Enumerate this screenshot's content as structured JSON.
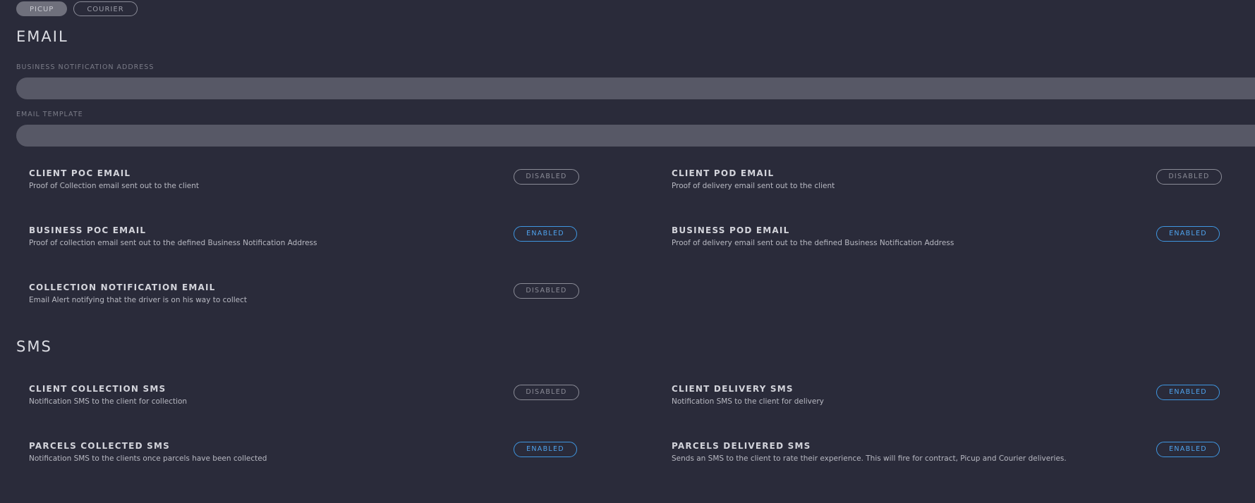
{
  "tabs": [
    {
      "label": "PICUP",
      "active": true
    },
    {
      "label": "COURIER",
      "active": false
    }
  ],
  "email": {
    "title": "EMAIL",
    "business_address_label": "BUSINESS NOTIFICATION ADDRESS",
    "business_address_value": "",
    "template_label": "EMAIL TEMPLATE",
    "template_value": "",
    "settings": [
      {
        "name": "CLIENT POC EMAIL",
        "desc": "Proof of Collection email sent out to the client",
        "status": "DISABLED"
      },
      {
        "name": "CLIENT POD EMAIL",
        "desc": "Proof of delivery email sent out to the client",
        "status": "DISABLED"
      },
      {
        "name": "BUSINESS POC EMAIL",
        "desc": "Proof of collection email sent out to the defined Business Notification Address",
        "status": "ENABLED"
      },
      {
        "name": "BUSINESS POD EMAIL",
        "desc": "Proof of delivery email sent out to the defined Business Notification Address",
        "status": "ENABLED"
      },
      {
        "name": "COLLECTION NOTIFICATION EMAIL",
        "desc": "Email Alert notifying that the driver is on his way to collect",
        "status": "DISABLED"
      }
    ]
  },
  "sms": {
    "title": "SMS",
    "settings": [
      {
        "name": "CLIENT COLLECTION SMS",
        "desc": "Notification SMS to the client for collection",
        "status": "DISABLED"
      },
      {
        "name": "CLIENT DELIVERY SMS",
        "desc": "Notification SMS to the client for delivery",
        "status": "ENABLED"
      },
      {
        "name": "PARCELS COLLECTED SMS",
        "desc": "Notification SMS to the clients once parcels have been collected",
        "status": "ENABLED"
      },
      {
        "name": "PARCELS DELIVERED SMS",
        "desc": "Sends an SMS to the client to rate their experience. This will fire for contract, Picup and Courier deliveries.",
        "status": "ENABLED"
      }
    ]
  },
  "colors": {
    "background": "#2a2b3a",
    "input": "#575866",
    "enabled": "#4ea3ee",
    "disabled": "#8a8b96"
  }
}
